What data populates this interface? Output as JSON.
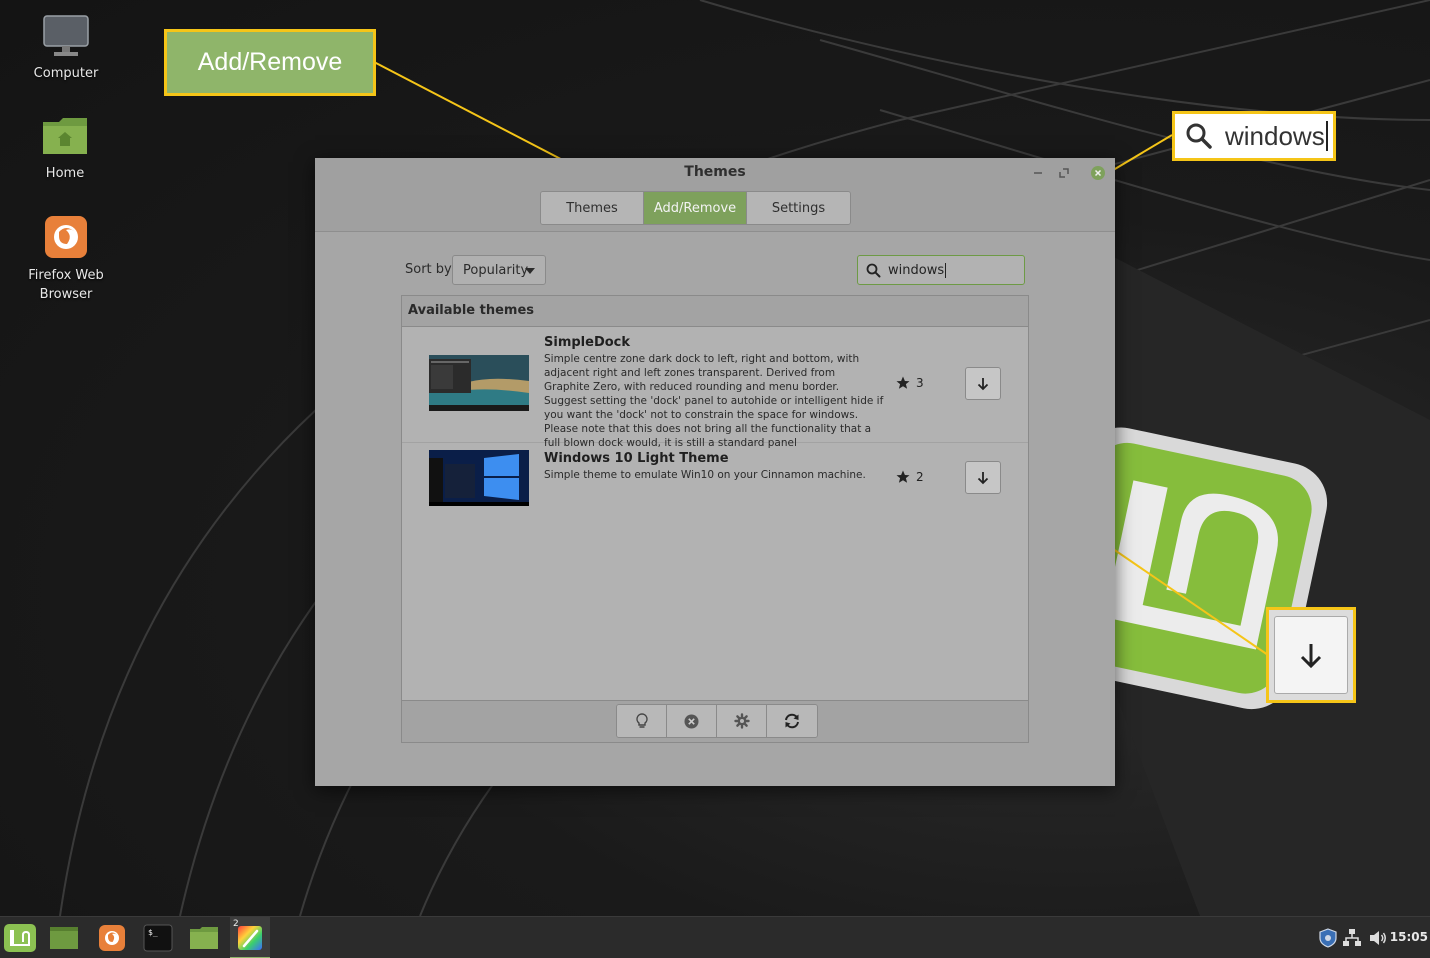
{
  "desktop": {
    "icons": [
      {
        "label": "Computer",
        "icon": "monitor-icon"
      },
      {
        "label": "Home",
        "icon": "home-folder-icon"
      },
      {
        "label": "Firefox Web Browser",
        "icon": "firefox-icon"
      }
    ]
  },
  "callouts": {
    "add_remove": "Add/Remove",
    "search_text": "windows",
    "download_icon": "download-arrow-icon",
    "highlight_color": "#f5c518"
  },
  "window": {
    "title": "Themes",
    "tabs": [
      {
        "label": "Themes",
        "active": false
      },
      {
        "label": "Add/Remove",
        "active": true
      },
      {
        "label": "Settings",
        "active": false
      }
    ],
    "sort_label": "Sort by",
    "sort_value": "Popularity",
    "search_value": "windows",
    "list_header": "Available themes",
    "themes": [
      {
        "name": "SimpleDock",
        "description": "Simple centre zone dark dock to left, right and bottom, with adjacent right and left zones transparent. Derived from Graphite Zero, with reduced rounding and menu border. Suggest setting the 'dock' panel to autohide or intelligent hide if you want the 'dock' not to constrain the space for windows. Please note that this does not bring all the functionality that a full blown dock would, it is still a standard panel",
        "score": "3"
      },
      {
        "name": "Windows 10 Light Theme",
        "description": "Simple theme to emulate Win10 on your Cinnamon machine.",
        "score": "2"
      }
    ],
    "footer_buttons": [
      "lightbulb-icon",
      "remove-icon",
      "gear-icon",
      "refresh-icon"
    ],
    "accent_color": "#7ea15c"
  },
  "taskbar": {
    "items": [
      "mint-menu-icon",
      "show-desktop-icon",
      "firefox-icon",
      "terminal-icon",
      "files-icon",
      "themes-app-icon"
    ],
    "workspace_badge": "2",
    "tray": [
      "shield-icon",
      "network-icon",
      "volume-icon"
    ],
    "clock": "15:05"
  }
}
